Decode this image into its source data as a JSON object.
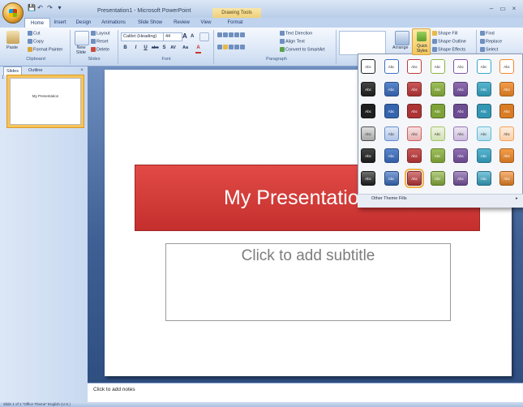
{
  "window": {
    "title": "Presentation1 - Microsoft PowerPoint",
    "context_tab": "Drawing Tools",
    "controls": [
      "–",
      "▭",
      "×"
    ]
  },
  "qat": [
    "💾",
    "↶",
    "↷",
    "▾"
  ],
  "tabs": [
    "Home",
    "Insert",
    "Design",
    "Animations",
    "Slide Show",
    "Review",
    "View",
    "Format"
  ],
  "active_tab": "Home",
  "ribbon": {
    "clipboard": {
      "label": "Clipboard",
      "paste": "Paste",
      "cut": "Cut",
      "copy": "Copy",
      "format_painter": "Format Painter"
    },
    "slides": {
      "label": "Slides",
      "new_slide": "New Slide",
      "layout": "Layout",
      "reset": "Reset",
      "delete": "Delete"
    },
    "font": {
      "label": "Font",
      "font_name": "Calibri (Heading)",
      "font_size": "44",
      "grow": "A",
      "shrink": "A",
      "buttons": [
        "B",
        "I",
        "U",
        "abc",
        "S",
        "AV",
        "Aa",
        "A"
      ]
    },
    "paragraph": {
      "label": "Paragraph",
      "text_direction": "Text Direction",
      "align_text": "Align Text",
      "convert_smartart": "Convert to SmartArt"
    },
    "drawing": {
      "arrange": "Arrange",
      "quick_styles": "Quick Styles",
      "shape_fill": "Shape Fill",
      "shape_outline": "Shape Outline",
      "shape_effects": "Shape Effects"
    },
    "editing": {
      "find": "Find",
      "replace": "Replace",
      "select": "Select"
    }
  },
  "panel": {
    "tabs": [
      "Slides",
      "Outline"
    ],
    "close": "×"
  },
  "thumbnail": {
    "number": "1",
    "text": "My Presentation"
  },
  "slide": {
    "title": "My Presentation",
    "subtitle_placeholder": "Click to add subtitle"
  },
  "notes": {
    "placeholder": "Click to add notes"
  },
  "status": {
    "left": "Slide 1 of 1    \"Office Theme\"    English (U.S.)"
  },
  "gallery": {
    "swatch_label": "Abc",
    "columns": [
      "#222222",
      "#3c6fc2",
      "#c0393a",
      "#8cb43e",
      "#7b55a3",
      "#38a8c8",
      "#f28a2a"
    ],
    "row_styles": [
      "outline",
      "solid",
      "solid-dark",
      "light",
      "solid",
      "intense"
    ],
    "selected": [
      5,
      2
    ],
    "more_label": "Other Theme Fills",
    "more_arrow": "▸"
  }
}
